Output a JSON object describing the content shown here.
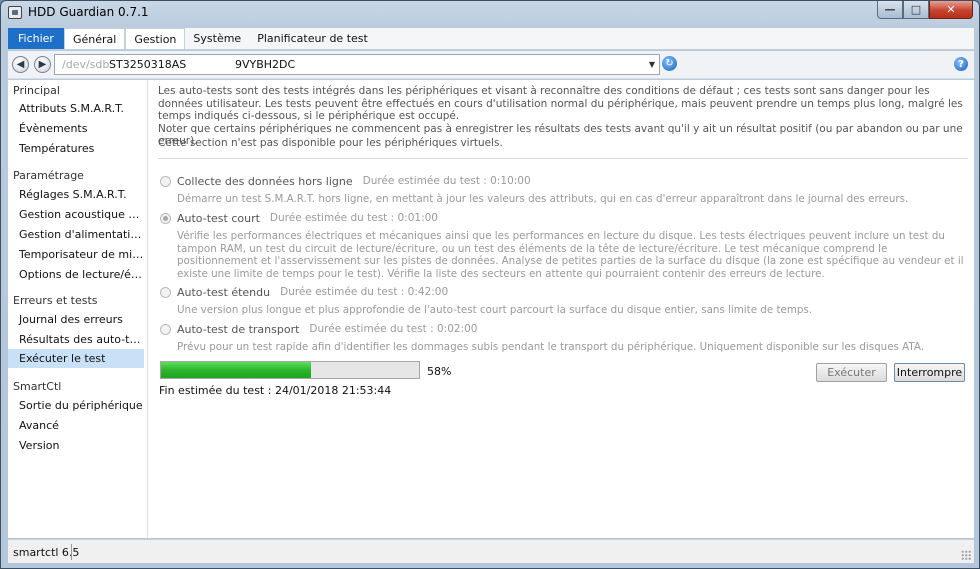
{
  "window": {
    "title": "HDD Guardian 0.7.1",
    "controls": {
      "minimize": "—",
      "maximize": "□",
      "close": "✕"
    }
  },
  "menu": {
    "items": [
      {
        "label": "Fichier"
      },
      {
        "label": "Général"
      },
      {
        "label": "Gestion"
      },
      {
        "label": "Système"
      },
      {
        "label": "Planificateur de test"
      }
    ]
  },
  "toolbar": {
    "back_icon": "◀",
    "forward_icon": "▶",
    "device": {
      "path": "/dev/sdb",
      "model": "ST3250318AS",
      "serial": "9VYBH2DC"
    },
    "dropdown_icon": "▼",
    "refresh_icon": "↻",
    "help_icon": "?"
  },
  "sidebar": {
    "sections": [
      {
        "header": "Principal",
        "items": [
          "Attributs S.M.A.R.T.",
          "Évènements",
          "Températures"
        ]
      },
      {
        "header": "Paramétrage",
        "items": [
          "Réglages S.M.A.R.T.",
          "Gestion acoustique avan…",
          "Gestion d'alimentation av…",
          "Temporisateur de mise e…",
          "Options de lecture/écriture"
        ]
      },
      {
        "header": "Erreurs et tests",
        "items": [
          "Journal des erreurs",
          "Résultats des auto-tests",
          "Exécuter le test"
        ]
      },
      {
        "header": "SmartCtl",
        "items": [
          "Sortie du périphérique",
          "Avancé",
          "Version"
        ]
      }
    ],
    "selected": "Exécuter le test"
  },
  "main": {
    "intro": "Les auto-tests sont des tests intégrés dans les périphériques et visant à reconnaître des conditions de défaut ; ces tests sont sans danger pour les données utilisateur. Les tests peuvent être effectués en cours d'utilisation normal du périphérique, mais peuvent prendre un temps plus long, malgré les temps indiqués ci-dessous, si le périphérique est occupé.",
    "intro_note": "Noter que certains périphériques ne commencent pas à enregistrer les résultats des tests avant qu'il y ait un résultat positif (ou par abandon ou par une erreur).",
    "unavailable": "Cette section n'est pas disponible pour les périphériques virtuels.",
    "options": [
      {
        "label": "Collecte des données hors ligne",
        "duration": "Durée estimée du test : 0:10:00",
        "description": "Démarre un test S.M.A.R.T. hors ligne, en mettant à jour les valeurs des attributs, qui en cas d'erreur apparaîtront dans le journal des erreurs.",
        "checked": false
      },
      {
        "label": "Auto-test court",
        "duration": "Durée estimée du test : 0:01:00",
        "description": "Vérifie les performances électriques et mécaniques ainsi que les performances en lecture du disque. Les tests électriques peuvent inclure un test du tampon RAM, un test du circuit de lecture/écriture, ou un test des éléments de la tête de lecture/écriture. Le test mécanique comprend le positionnement et l'asservissement sur les pistes de données. Analyse de petites parties de la surface du disque (la zone est spécifique au vendeur et il existe une limite de temps pour le test). Vérifie la liste des secteurs en attente qui pourraient contenir des erreurs de lecture.",
        "checked": true
      },
      {
        "label": "Auto-test étendu",
        "duration": "Durée estimée du test : 0:42:00",
        "description": "Une version plus longue et plus approfondie de l'auto-test court parcourt la surface du disque entier, sans limite de temps.",
        "checked": false
      },
      {
        "label": "Auto-test de transport",
        "duration": "Durée estimée du test : 0:02:00",
        "description": "Prévu pour un test rapide afin d'identifier les dommages subis pendant le transport du périphérique. Uniquement disponible sur les disques ATA.",
        "checked": false
      }
    ],
    "progress": {
      "percent": 58,
      "label": "58%"
    },
    "eta": "Fin estimée du test : 24/01/2018 21:53:44",
    "buttons": {
      "execute": "Exécuter",
      "abort": "Interrompre"
    }
  },
  "statusbar": {
    "text": "smartctl 6.5"
  },
  "colors": {
    "accent": "#1e6fc8",
    "selection": "#c9e1f7",
    "progress": "#2cb52c"
  }
}
